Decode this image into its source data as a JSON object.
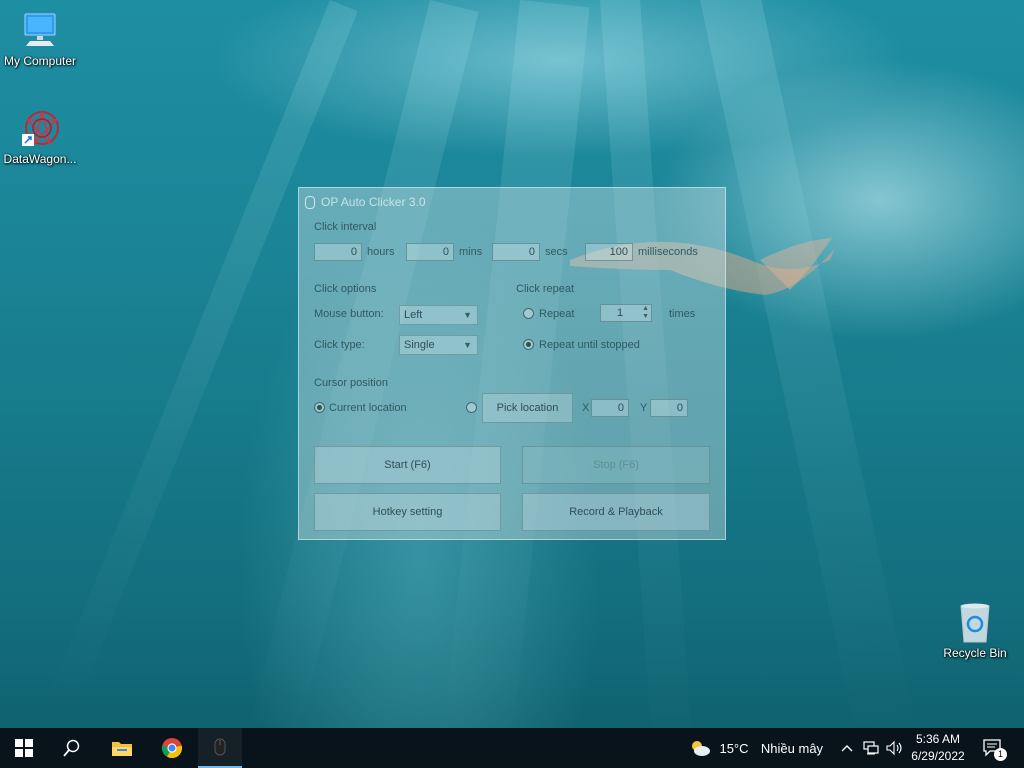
{
  "desktop": {
    "icons": [
      {
        "name": "my-computer",
        "label": "My Computer"
      },
      {
        "name": "datawagon",
        "label": "DataWagon..."
      },
      {
        "name": "recycle-bin",
        "label": "Recycle Bin"
      }
    ]
  },
  "app": {
    "title": "OP Auto Clicker 3.0",
    "click_interval": {
      "label": "Click interval",
      "hours": {
        "value": "0",
        "unit": "hours"
      },
      "mins": {
        "value": "0",
        "unit": "mins"
      },
      "secs": {
        "value": "0",
        "unit": "secs"
      },
      "ms": {
        "value": "100",
        "unit": "milliseconds"
      }
    },
    "click_options": {
      "label": "Click options",
      "mouse_button_label": "Mouse button:",
      "mouse_button_value": "Left",
      "click_type_label": "Click type:",
      "click_type_value": "Single"
    },
    "click_repeat": {
      "label": "Click repeat",
      "repeat_label": "Repeat",
      "repeat_count": "1",
      "times_label": "times",
      "until_stopped_label": "Repeat until stopped"
    },
    "cursor_position": {
      "label": "Cursor position",
      "current_label": "Current location",
      "pick_label": "Pick location",
      "x_label": "X",
      "x_value": "0",
      "y_label": "Y",
      "y_value": "0"
    },
    "buttons": {
      "start": "Start (F6)",
      "stop": "Stop (F6)",
      "hotkey": "Hotkey setting",
      "record": "Record & Playback"
    }
  },
  "taskbar": {
    "weather": {
      "temp": "15°C",
      "desc": "Nhiều mây"
    },
    "time": "5:36 AM",
    "date": "6/29/2022",
    "notification_count": "1"
  }
}
